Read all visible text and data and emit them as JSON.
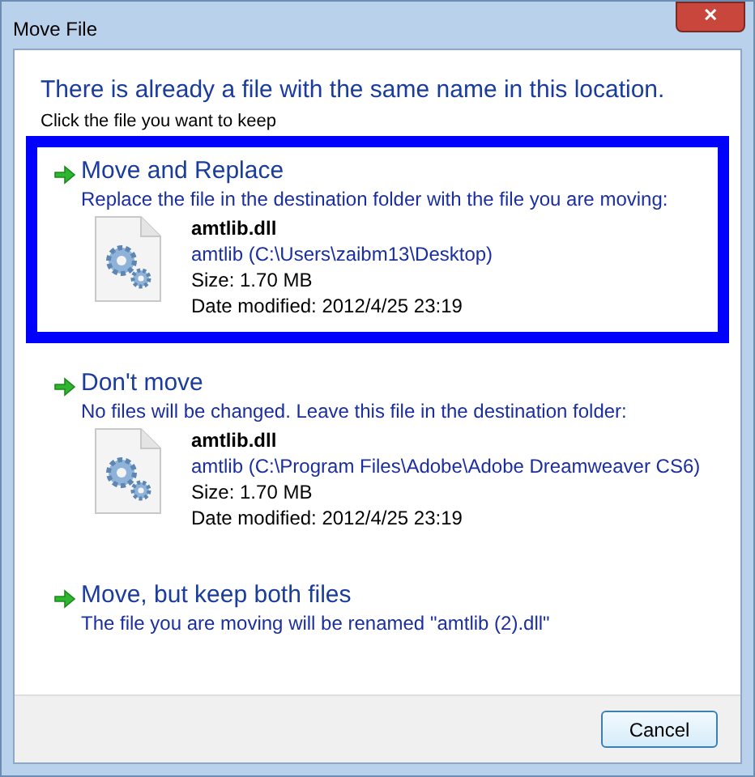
{
  "window": {
    "title": "Move File",
    "close": "✕"
  },
  "heading": "There is already a file with the same name in this location.",
  "instruction": "Click the file you want to keep",
  "options": [
    {
      "kind": "file",
      "selected": true,
      "title": "Move and Replace",
      "description": "Replace the file in the destination folder with the file you are moving:",
      "file": {
        "name": "amtlib.dll",
        "location": "amtlib (C:\\Users\\zaibm13\\Desktop)",
        "size": "Size: 1.70 MB",
        "modified": "Date modified: 2012/4/25 23:19"
      }
    },
    {
      "kind": "file",
      "selected": false,
      "title": "Don't move",
      "description": "No files will be changed. Leave this file in the destination folder:",
      "file": {
        "name": "amtlib.dll",
        "location": "amtlib (C:\\Program Files\\Adobe\\Adobe Dreamweaver CS6)",
        "size": "Size: 1.70 MB",
        "modified": "Date modified: 2012/4/25 23:19"
      }
    },
    {
      "kind": "plain",
      "selected": false,
      "title": "Move, but keep both files",
      "description": "The file you are moving will be renamed \"amtlib (2).dll\""
    }
  ],
  "buttons": [
    "Cancel"
  ]
}
